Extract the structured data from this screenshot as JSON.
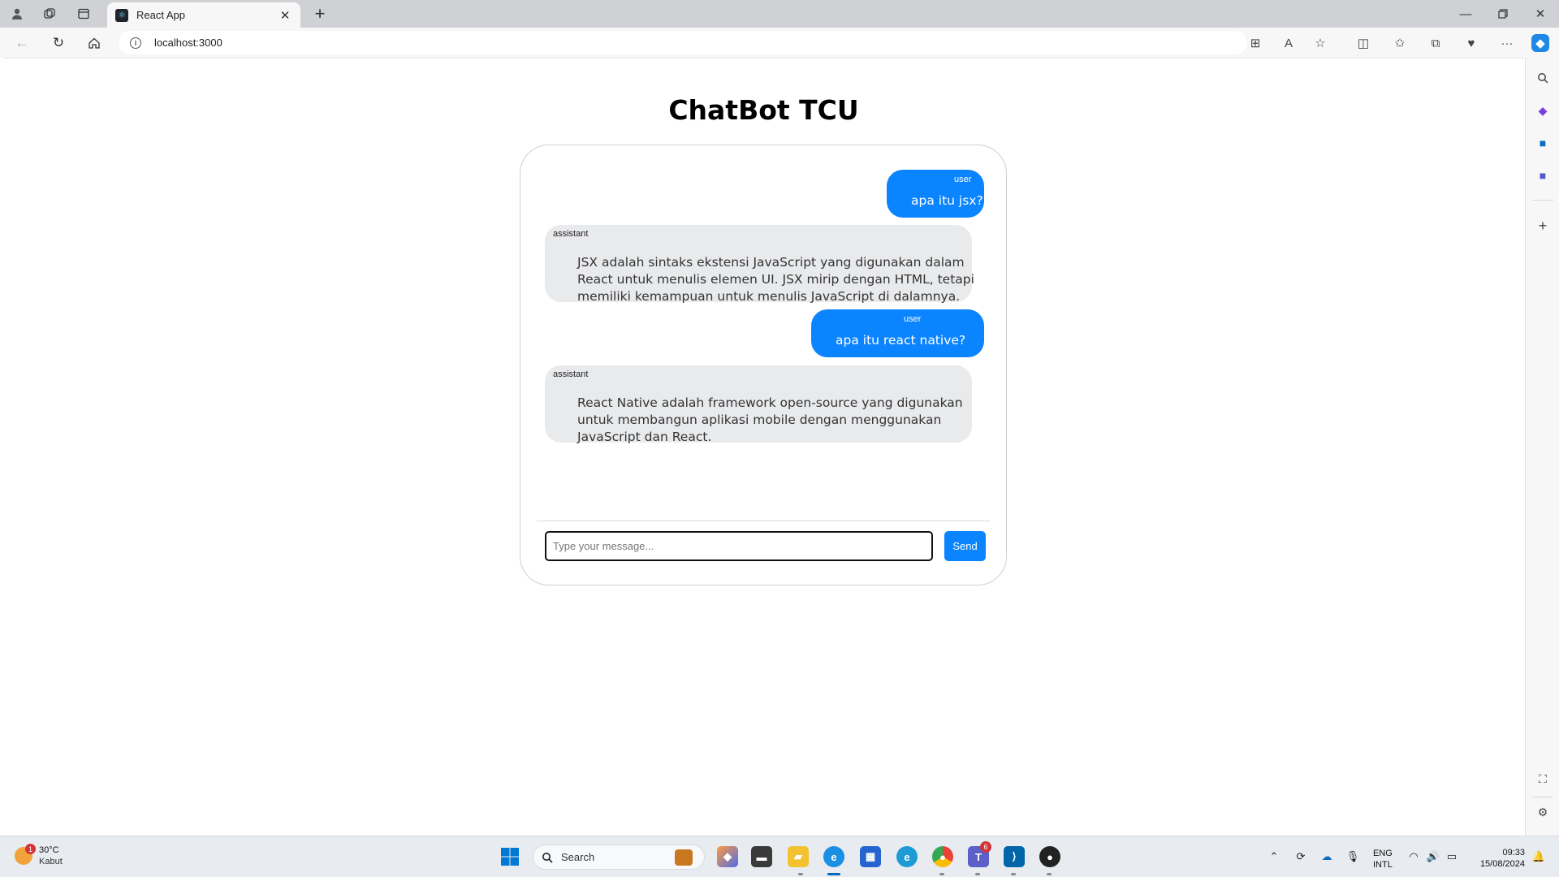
{
  "browser": {
    "tab_title": "React App",
    "url": "localhost:3000"
  },
  "page": {
    "title": "ChatBot TCU"
  },
  "chat": {
    "messages": [
      {
        "role": "user",
        "text": "apa itu jsx?"
      },
      {
        "role": "assistant",
        "lines": [
          "JSX adalah sintaks ekstensi JavaScript yang digunakan dalam",
          "React untuk menulis elemen UI. JSX mirip dengan HTML, tetapi",
          "memiliki kemampuan untuk menulis JavaScript di dalamnya."
        ]
      },
      {
        "role": "user",
        "text": "apa itu react native?"
      },
      {
        "role": "assistant",
        "lines": [
          "React Native adalah framework open-source yang digunakan",
          "untuk membangun aplikasi mobile dengan menggunakan",
          "JavaScript dan React."
        ]
      }
    ],
    "input_placeholder": "Type your message...",
    "input_value": "",
    "send_label": "Send"
  },
  "taskbar": {
    "weather": {
      "temp": "30°C",
      "condition": "Kabut",
      "badge": "1"
    },
    "search_label": "Search",
    "teams_badge": "6",
    "language": {
      "line1": "ENG",
      "line2": "INTL"
    },
    "clock": {
      "time": "09:33",
      "date": "15/08/2024"
    }
  },
  "colors": {
    "user_bubble": "#0a84ff",
    "assistant_bubble": "#e9eaec",
    "send_button": "#0a84ff"
  }
}
